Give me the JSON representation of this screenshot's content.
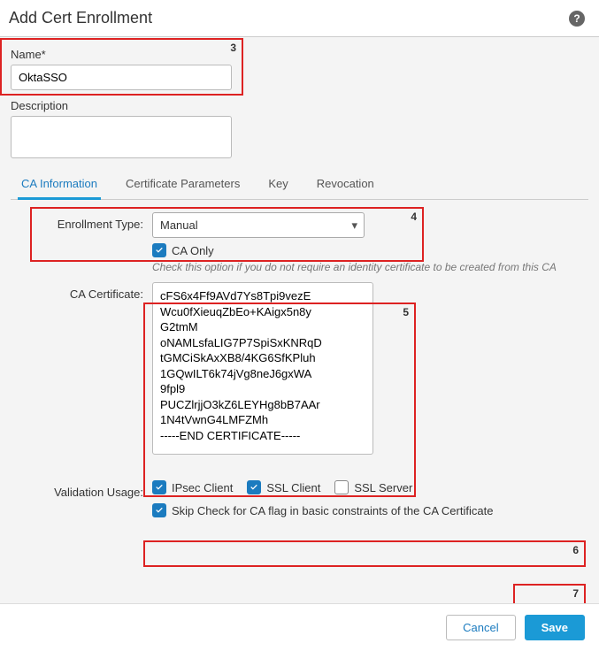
{
  "dialog": {
    "title": "Add Cert Enrollment"
  },
  "fields": {
    "name_label": "Name*",
    "name_value": "OktaSSO",
    "description_label": "Description",
    "description_value": ""
  },
  "tabs": {
    "ca_info": "CA Information",
    "cert_params": "Certificate Parameters",
    "key": "Key",
    "revocation": "Revocation"
  },
  "ca_info": {
    "enrollment_type_label": "Enrollment Type:",
    "enrollment_type_value": "Manual",
    "ca_only_label": "CA Only",
    "ca_only_hint": "Check this option if you do not require an identity certificate to be created from this CA",
    "ca_certificate_label": "CA Certificate:",
    "ca_certificate_value": "cFS6x4Ff9AVd7Ys8Tpi9vezE\nWcu0fXieuqZbEo+KAigx5n8y\nG2tmM\noNAMLsfaLIG7P7SpiSxKNRqD\ntGMCiSkAxXB8/4KG6SfKPluh\n1GQwILT6k74jVg8neJ6gxWA\n9fpl9\nPUCZlrjjO3kZ6LEYHg8bB7AAr\n1N4tVwnG4LMFZMh\n-----END CERTIFICATE-----",
    "validation_usage_label": "Validation Usage:",
    "ipsec_client": "IPsec Client",
    "ssl_client": "SSL Client",
    "ssl_server": "SSL Server",
    "skip_check_label": "Skip Check for CA flag in basic constraints of the CA Certificate"
  },
  "buttons": {
    "cancel": "Cancel",
    "save": "Save"
  },
  "annotations": {
    "a3": "3",
    "a4": "4",
    "a5": "5",
    "a6": "6",
    "a7": "7"
  }
}
